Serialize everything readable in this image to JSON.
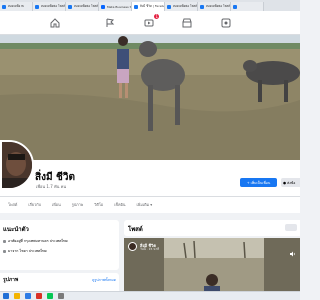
{
  "browser": {
    "tabs": [
      {
        "title": "ทอดเหยื่อ fb",
        "color": "#1877f2"
      },
      {
        "title": "ทอดเหยื่อพอ โพสต์",
        "color": "#1877f2"
      },
      {
        "title": "ทอดเหยื่อพอ โพสต์",
        "color": "#1877f2"
      },
      {
        "title": "Meta Business Suite",
        "color": "#0866ff"
      },
      {
        "title": "สิงมี ชีวิต | Facebook",
        "color": "#1877f2"
      },
      {
        "title": "ทอดเหยื่อพอ โพสต์ใหม่",
        "color": "#1877f2"
      },
      {
        "title": "ทอดเหยื่อพอ โพสต์",
        "color": "#1877f2"
      },
      {
        "title": "",
        "color": "#1877f2"
      }
    ],
    "active_tab_index": 4
  },
  "fbnav": {
    "notification_count": "1"
  },
  "profile": {
    "name": "สิ่งมี ชีวิต",
    "friends": "เพื่อน 1.7 พัน คน",
    "add_friend_label": "เพิ่มเป็นเพื่อน",
    "message_label": "ส่งข้อ"
  },
  "profile_tabs": [
    "โพสต์",
    "เกี่ยวกับ",
    "เพื่อน",
    "รูปภาพ",
    "วิดีโอ",
    "เช็คอิน",
    "เพิ่มเติม ▾"
  ],
  "intro": {
    "heading": "แนะนำตัว",
    "rows": [
      "อาศัยอยู่ที่ กรุงเทพมหานคร ประเทศไทย",
      "มาจาก ไชยา ประเทศไทย"
    ]
  },
  "photos": {
    "heading": "รูปภาพ",
    "see_all": "ดูรูปภาพทั้งหมด"
  },
  "posts": {
    "heading": "โพสต์"
  },
  "post": {
    "author": "สิ่งมี ชีวิต",
    "time": "วันนี้ · 15 นาที"
  },
  "colors": {
    "fb_blue": "#1877f2",
    "badge_red": "#e41e3f"
  }
}
